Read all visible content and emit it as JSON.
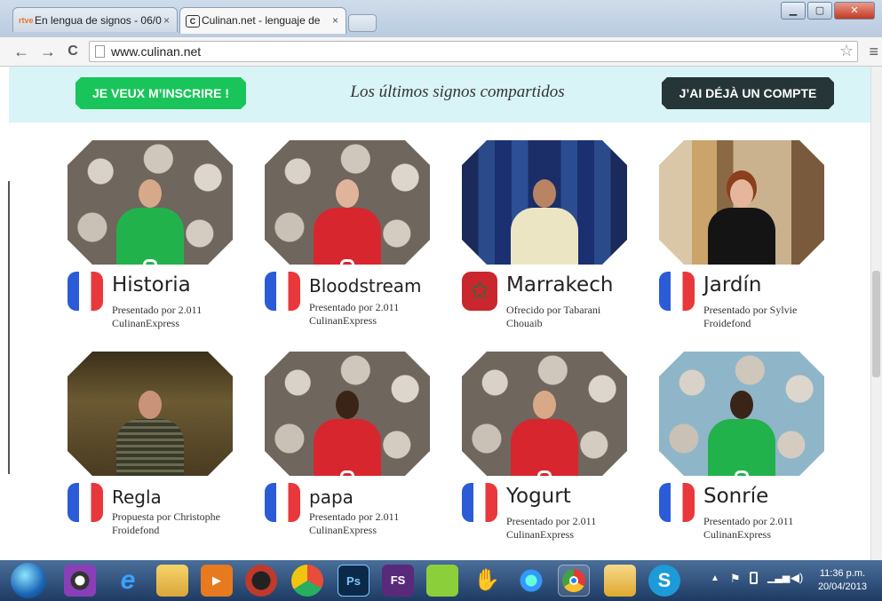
{
  "browser": {
    "tabs": [
      {
        "label": "En lengua de signos - 06/0",
        "favicon": "rtve"
      },
      {
        "label": "Culinan.net - lenguaje de",
        "favicon": "C"
      }
    ],
    "url": "www.culinan.net",
    "close_glyph": "×"
  },
  "header": {
    "signup_label": "JE VEUX M’INSCRIRE !",
    "title": "Los últimos signos compartidos",
    "login_label": "J’AI DÉJÀ UN COMPTE"
  },
  "cards": [
    {
      "word": "Historia",
      "line1": "Presentado por 2.011",
      "line2": "CulinanExpress",
      "flag": "fr"
    },
    {
      "word": "Bloodstream",
      "line1": "Presentado por 2.011",
      "line2": "CulinanExpress",
      "flag": "fr"
    },
    {
      "word": "Marrakech",
      "line1": "Ofrecido por Tabarani",
      "line2": "Chouaib",
      "flag": "ma"
    },
    {
      "word": "Jardín",
      "line1": "Presentado por Sylvie",
      "line2": "Froidefond",
      "flag": "fr"
    },
    {
      "word": "Regla",
      "line1": "Propuesta por Christophe",
      "line2": "Froidefond",
      "flag": "fr"
    },
    {
      "word": "papa",
      "line1": "Presentado por 2.011",
      "line2": "CulinanExpress",
      "flag": "fr"
    },
    {
      "word": "Yogurt",
      "line1": "Presentado por 2.011",
      "line2": "CulinanExpress",
      "flag": "fr"
    },
    {
      "word": "Sonríe",
      "line1": "Presentado por 2.011",
      "line2": "CulinanExpress",
      "flag": "fr"
    }
  ],
  "taskbar": {
    "photoshop_label": "Ps",
    "fs_label": "FS",
    "time": "11:36 p.m.",
    "date": "20/04/2013"
  },
  "colors": {
    "signup": "#19c55a",
    "login": "#263538",
    "header_bg": "#d9f4f6"
  }
}
